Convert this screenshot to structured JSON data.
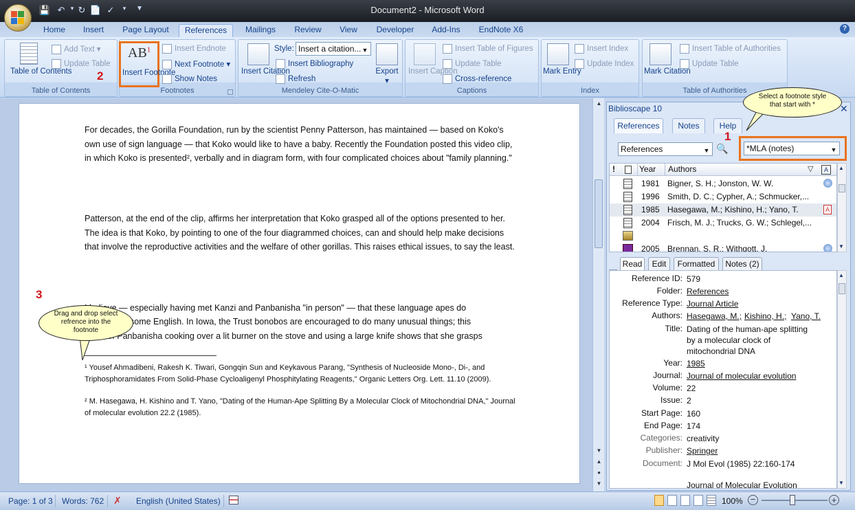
{
  "window": {
    "title": "Document2 - Microsoft Word"
  },
  "quick_access": [
    "save-icon",
    "undo-icon",
    "redo-icon",
    "print-preview-icon",
    "spelling-icon",
    "customize-icon"
  ],
  "ribbon_tabs": [
    "Home",
    "Insert",
    "Page Layout",
    "References",
    "Mailings",
    "Review",
    "View",
    "Developer",
    "Add-Ins",
    "EndNote X6"
  ],
  "active_tab": "References",
  "groups": {
    "toc": {
      "label": "Table of Contents",
      "toc_btn": "Table of Contents",
      "add_text": "Add Text",
      "update_table": "Update Table"
    },
    "footnotes": {
      "label": "Footnotes",
      "insert_footnote": "Insert Footnote",
      "insert_endnote": "Insert Endnote",
      "next_footnote": "Next Footnote",
      "show_notes": "Show Notes"
    },
    "mendeley": {
      "label": "Mendeley Cite-O-Matic",
      "insert_citation": "Insert Citation",
      "style_label": "Style:",
      "style_value": "Insert a citation...",
      "insert_bibliography": "Insert Bibliography",
      "refresh": "Refresh",
      "export": "Export"
    },
    "captions": {
      "label": "Captions",
      "insert_caption": "Insert Caption",
      "insert_table_of_figures": "Insert Table of Figures",
      "update_table": "Update Table",
      "cross_reference": "Cross-reference"
    },
    "index": {
      "label": "Index",
      "mark_entry": "Mark Entry",
      "insert_index": "Insert Index",
      "update_index": "Update Index"
    },
    "authorities": {
      "label": "Table of Authorities",
      "mark_citation": "Mark Citation",
      "insert_table": "Insert Table of Authorities",
      "update_table": "Update Table"
    }
  },
  "annotations": {
    "step1": "1",
    "step2": "2",
    "step3": "3",
    "callout_top": "Select a footnote style that start with *",
    "callout_drag": "Drag and drop select refrence into the footnote"
  },
  "document": {
    "p1": "For decades, the Gorilla Foundation, run by the scientist Penny Patterson, has maintained — based on Koko's own use of sign language — that Koko would like to have a baby. Recently the Foundation posted this video clip,  in which Koko is presented², verbally and in diagram form, with four complicated choices about \"family planning.\"",
    "p2": "Patterson, at the end of the clip, affirms her interpretation that Koko grasped all of the options presented to her. The idea is that Koko, by pointing to one of the four diagrammed choices, can and should help make decisions that involve the reproductive activities and the welfare of other gorillas.  This raises ethical issues, to say the least.",
    "p3_l1": "I believe — especially having met Kanzi and Panbanisha \"in person\" — that these language apes do",
    "p3_l2": "understand some English. In Iowa, the Trust bonobos are encouraged to do many unusual things; this",
    "p3_l3": "video of Panbanisha cooking over a lit burner on the stove and using a large knife shows that she grasps",
    "fn1": "¹ Yousef Ahmadibeni, Rakesh K. Tiwari, Gongqin Sun and Keykavous Parang, \"Synthesis of Nucleoside Mono-, Di-, and Triphosphoramidates From Solid-Phase Cycloaligenyl Phosphitylating Reagents,\" Organic Letters Org. Lett. 11.10 (2009).",
    "fn2": "² M. Hasegawa, H. Kishino and T. Yano, \"Dating of the Human-Ape Splitting By a Molecular Clock of Mitochondrial DNA,\" Journal of molecular evolution 22.2 (1985)."
  },
  "biblioscape": {
    "title": "Biblioscape 10",
    "tabs": [
      "References",
      "Notes",
      "Help"
    ],
    "source_combo": "References",
    "style_combo": "*MLA (notes)",
    "columns": {
      "year": "Year",
      "authors": "Authors"
    },
    "rows": [
      {
        "year": "1981",
        "authors": "Bigner, S. H.; Jonston, W. W.",
        "icon": "globe-icon"
      },
      {
        "year": "1996",
        "authors": "Smith, D. C.; Cypher, A.; Schmucker,...",
        "icon": ""
      },
      {
        "year": "1985",
        "authors": "Hasegawa, M.; Kishino, H.; Yano, T.",
        "icon": "pdf-icon",
        "selected": true
      },
      {
        "year": "2004",
        "authors": "Frisch, M. J.; Trucks, G. W.; Schlegel,...",
        "icon": ""
      },
      {
        "year": "",
        "authors": "",
        "icon": ""
      },
      {
        "year": "2005",
        "authors": "Brennan, S. R.; Withgott, J.",
        "icon": "globe-icon"
      }
    ],
    "detail_tabs": [
      "Read",
      "Edit",
      "Formatted",
      "Notes (2)"
    ],
    "detail": {
      "reference_id_label": "Reference ID:",
      "reference_id": "579",
      "folder_label": "Folder:",
      "folder": "References",
      "type_label": "Reference Type:",
      "type": "Journal Article",
      "authors_label": "Authors:",
      "authors": [
        "Hasegawa, M.;",
        "Kishino, H.;",
        "Yano, T."
      ],
      "title_label": "Title:",
      "title": [
        "Dating of the human-ape splitting",
        "by a molecular clock of",
        "mitochondrial DNA"
      ],
      "year_label": "Year:",
      "year": "1985",
      "journal_label": "Journal:",
      "journal": "Journal of molecular evolution",
      "volume_label": "Volume:",
      "volume": "22",
      "issue_label": "Issue:",
      "issue": "2",
      "start_page_label": "Start Page:",
      "start_page": "160",
      "end_page_label": "End Page:",
      "end_page": "174",
      "categories_label": "Categories:",
      "categories": "creativity",
      "publisher_label": "Publisher:",
      "publisher": "Springer",
      "document_label": "Document:",
      "document": "J Mol Evol (1985) 22:160-174",
      "document2": "Journal of Molecular Evolution"
    }
  },
  "status": {
    "page": "Page: 1 of 3",
    "words": "Words: 762",
    "language": "English (United States)",
    "zoom": "100%"
  }
}
